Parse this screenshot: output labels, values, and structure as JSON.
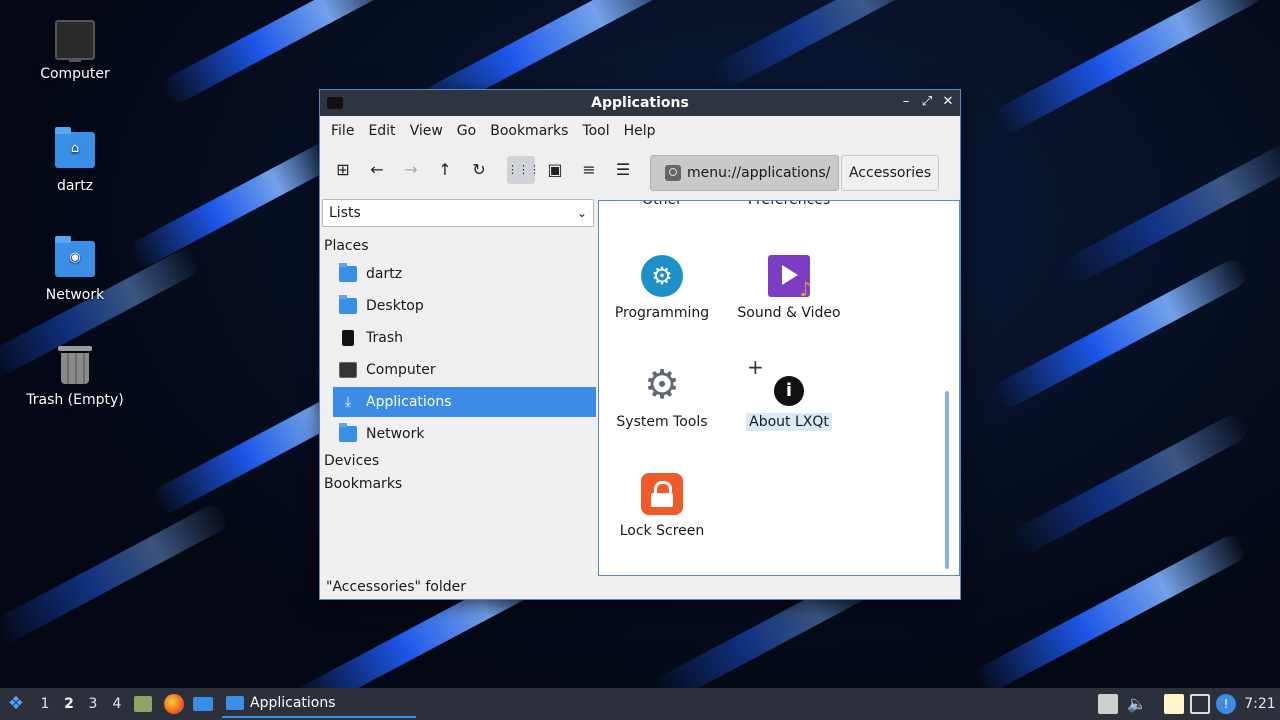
{
  "desktop": {
    "icons": [
      {
        "label": "Computer"
      },
      {
        "label": "dartz"
      },
      {
        "label": "Network"
      },
      {
        "label": "Trash (Empty)"
      }
    ]
  },
  "window": {
    "title": "Applications",
    "controls": {
      "minimize": "–",
      "restore": "⤢",
      "close": "✕"
    },
    "menu": [
      "File",
      "Edit",
      "View",
      "Go",
      "Bookmarks",
      "Tool",
      "Help"
    ],
    "toolbar": {
      "new_tab": "⊞",
      "back": "←",
      "forward": "→",
      "up": "↑",
      "reload": "↻",
      "icon_view": "⋮⋮⋮",
      "thumbnail_view": "▣",
      "compact_view": "≡",
      "detailed_view": "☰"
    },
    "path": {
      "root": "menu://applications/",
      "current": "Accessories"
    },
    "side": {
      "selector": "Lists",
      "places_heading": "Places",
      "places": [
        {
          "label": "dartz",
          "icon": "home-folder-icon"
        },
        {
          "label": "Desktop",
          "icon": "desktop-icon"
        },
        {
          "label": "Trash",
          "icon": "trash-icon"
        },
        {
          "label": "Computer",
          "icon": "computer-icon"
        },
        {
          "label": "Applications",
          "icon": "applications-icon",
          "selected": true
        },
        {
          "label": "Network",
          "icon": "network-folder-icon"
        }
      ],
      "devices_heading": "Devices",
      "bookmarks_heading": "Bookmarks"
    },
    "apps": {
      "partial_top": [
        "Other",
        "Preferences"
      ],
      "items": [
        {
          "label": "Programming",
          "icon": "programming-icon"
        },
        {
          "label": "Sound & Video",
          "icon": "sound-video-icon"
        },
        {
          "label": "System Tools",
          "icon": "system-tools-icon"
        },
        {
          "label": "About LXQt",
          "icon": "info-icon",
          "selected": true
        },
        {
          "label": "Lock Screen",
          "icon": "lock-icon"
        }
      ]
    },
    "status": "\"Accessories\" folder"
  },
  "taskbar": {
    "desktops": [
      "1",
      "2",
      "3",
      "4"
    ],
    "current_desktop": "2",
    "task_label": "Applications",
    "clock": "7:21"
  },
  "colors": {
    "selection": "#3c8ce6",
    "titlebar": "#2f3540",
    "taskbar": "#2b303a"
  }
}
